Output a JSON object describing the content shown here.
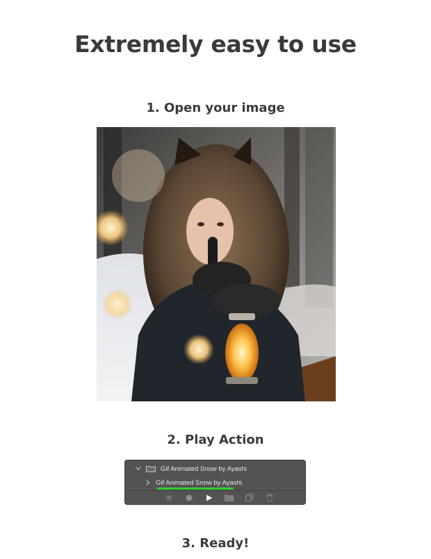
{
  "page": {
    "headline": "Extremely easy to use",
    "steps": [
      {
        "title": "1. Open your image"
      },
      {
        "title": "2. Play Action"
      },
      {
        "title": "3. Ready!"
      }
    ]
  },
  "actions_panel": {
    "set_name": "Gif Animated Snow by Ayashi",
    "action_name": "Gif Animated Snow by Ayashi",
    "toolbar_icons": [
      "stop-icon",
      "record-icon",
      "play-icon",
      "folder-icon",
      "new-action-icon",
      "trash-icon"
    ],
    "highlight_color": "#2fd12f",
    "panel_color": "#535353"
  }
}
